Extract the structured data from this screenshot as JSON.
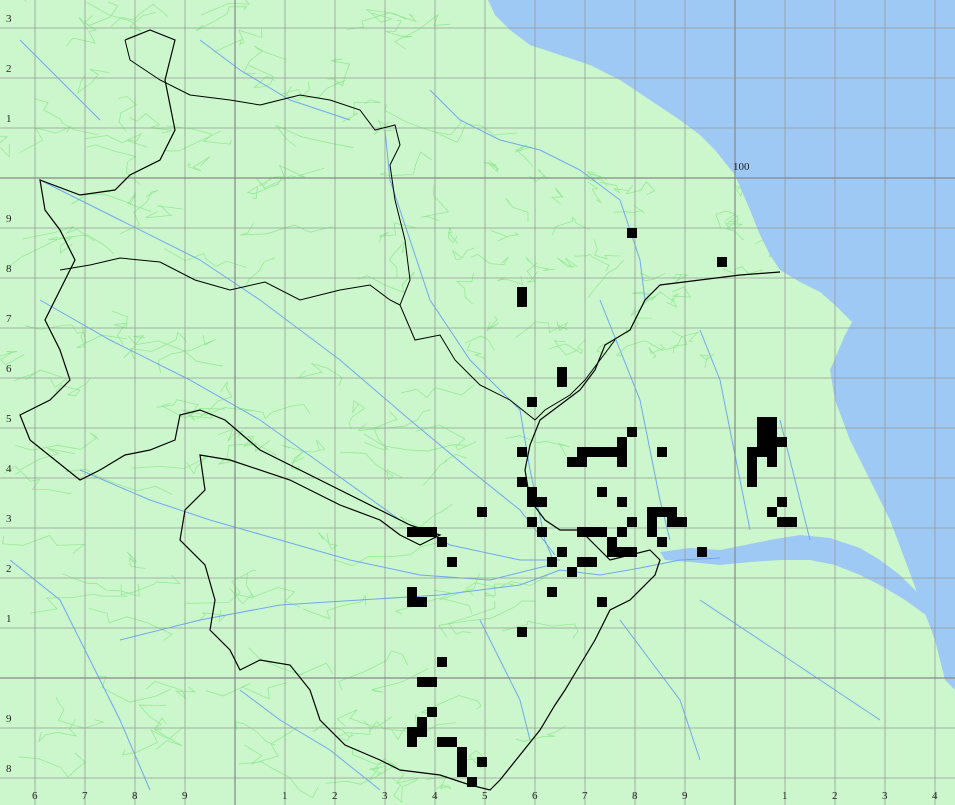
{
  "map": {
    "colors": {
      "land": "#ccf7cc",
      "sea": "#9ec9f5",
      "river": "#6fa8f0",
      "contour": "#66e066",
      "grid": "#999999",
      "boundary": "#000000",
      "record": "#000000"
    },
    "grid_label_hundred": "100",
    "left_tick_labels": [
      "3",
      "2",
      "1",
      "",
      "9",
      "8",
      "7",
      "6",
      "5",
      "4",
      "3",
      "2",
      "1",
      "",
      "9",
      "8"
    ],
    "bottom_tick_labels": [
      "6",
      "7",
      "8",
      "9",
      "",
      "1",
      "2",
      "3",
      "4",
      "5",
      "6",
      "7",
      "8",
      "9",
      "",
      "1",
      "2",
      "3",
      "4"
    ],
    "record_count": 96
  }
}
